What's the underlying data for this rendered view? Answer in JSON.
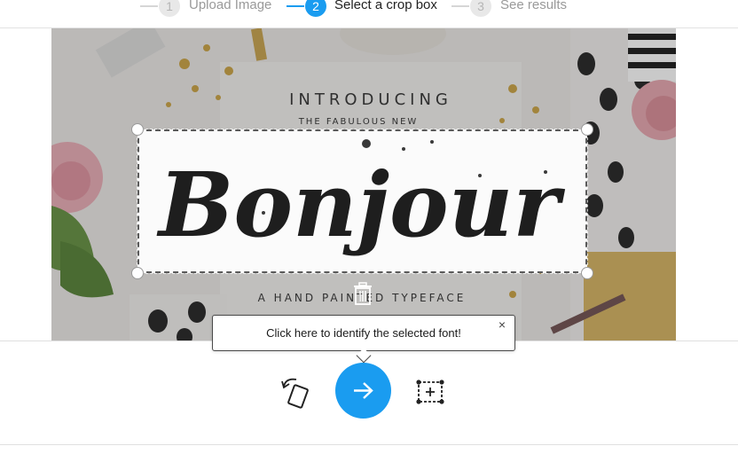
{
  "stepper": {
    "steps": [
      {
        "number": "1",
        "label": "Upload Image",
        "state": "done"
      },
      {
        "number": "2",
        "label": "Select a crop box",
        "state": "active"
      },
      {
        "number": "3",
        "label": "See results",
        "state": "pending"
      }
    ]
  },
  "image": {
    "headline_text": "INTRODUCING",
    "subline_text": "THE FABULOUS NEW",
    "script_text": "Bonjour",
    "footer_text": "A HAND PAINTED TYPEFACE"
  },
  "tooltip": {
    "text": "Click here to identify the selected font!",
    "close_glyph": "×"
  },
  "toolbar": {
    "rotate_icon": "rotate-icon",
    "next_icon": "arrow-right-icon",
    "add_box_icon": "add-crop-box-icon"
  },
  "colors": {
    "accent": "#1a9cf0",
    "inactive": "#b5b5b5",
    "border": "#e0e0e0"
  }
}
